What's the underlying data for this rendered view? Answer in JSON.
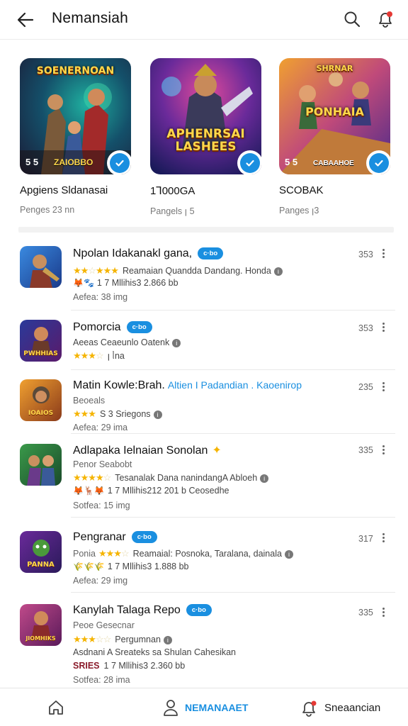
{
  "header": {
    "title": "Nemansiah",
    "back_icon": "arrow-left-icon",
    "search_icon": "search-icon",
    "notification_icon": "bell-icon"
  },
  "featured": [
    {
      "art_title": "SOENERNOAN",
      "art_bottom": "ZAIOBBO",
      "corner_num": "5 5",
      "name": "Apgiens Sldanasai",
      "sub": "Penges 23 nn"
    },
    {
      "art_title": "APHENRSAI LASHEES",
      "art_bottom": "",
      "corner_num": "",
      "name": "1Ꞁ000GA",
      "sub": "Pangels ꞁ 5"
    },
    {
      "art_title": "PONHAIA",
      "art_bottom": "CABAAHOE",
      "corner_num": "5 5",
      "name": "SCOBAK",
      "sub": "Panges ꞁ3"
    }
  ],
  "apps": [
    {
      "title": "Npolan Idakanakl gana,",
      "badge": "c·bo",
      "link": "",
      "rating": 4,
      "line1": "Reamaian Quandda Dandang. Honda",
      "line2": "1 7 Mllihis3 2.866 bb",
      "line2_emoji": "🦊🐾",
      "line3": "Aefea: 38 img",
      "line4": "",
      "count": "353"
    },
    {
      "title": "Pomorcia",
      "badge": "c·bo",
      "link": "",
      "rating": 3,
      "line1": "Aeeas Ceaeunlo Oatenk",
      "line2": "ꞁ ᥣna",
      "line2_emoji": "",
      "line3": "",
      "line4": "",
      "count": "353",
      "subline_is_stars": true
    },
    {
      "title": "Matin Kowle:Brah.",
      "badge": "",
      "link": "Altien I Padandian . Kaoenirop",
      "rating": 3,
      "line1": "Beoeals",
      "line2": "S 3 Sriegons",
      "line2_emoji": "",
      "line3": "Aefea: 29 ima",
      "line4": "",
      "count": "235",
      "stars_on_line2": true
    },
    {
      "title": "Adlapaka Ielnaian Sonolan",
      "badge": "",
      "link": "",
      "rating": 4,
      "line1": "Penor Seabobt",
      "line2": "Tesanalak Dana nanindangA Abloeh",
      "line2_emoji": "",
      "line3": "1 7 Mllihis212 201 b Ceosedhe",
      "line3_emoji": "🦊🦌🦊",
      "line4": "Sotfea: 15 img",
      "count": "335",
      "stars_on_line2": true
    },
    {
      "title": "Pengranar",
      "badge": "c·bo",
      "link": "",
      "rating": 4,
      "line1": "Ponia",
      "line1b": "Reamaial: Posnoka, Taralana, dainala",
      "line2": "1 7 Mllihis3 1.888 bb",
      "line2_emoji": "🌾🌾🌾",
      "line3": "Aefea: 29 img",
      "line4": "",
      "count": "317"
    },
    {
      "title": "Kanylah Talaga Repo",
      "badge": "c·bo",
      "link": "",
      "rating": 3,
      "line1": "Peoe Gesecnar",
      "line2": "Pergumnan",
      "line3": "Asdnani A Sreateks sa Shulan Cahesikan",
      "line4": "1 7 Mllihis3 2.360 bb",
      "line4_prefix": "SRIES",
      "line5": "Sotfea: 28 ima",
      "count": "335"
    }
  ],
  "bottom_nav": {
    "home_icon": "home-icon",
    "people_label": "NEMANAAET",
    "people_icon": "person-icon",
    "alerts_label": "Sneaancian",
    "alerts_icon": "bell-alert-icon"
  },
  "colors": {
    "accent": "#1a8fe0",
    "star": "#f5b400",
    "notif_dot": "#e53935"
  }
}
